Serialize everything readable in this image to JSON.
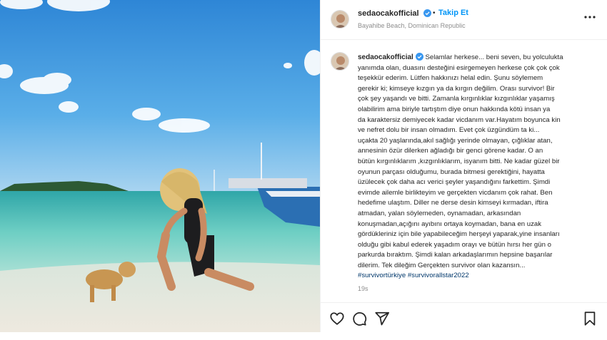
{
  "post": {
    "username": "sedaocakofficial",
    "verified": true,
    "follow_label": "Takip Et",
    "separator": "•",
    "location": "Bayahibe Beach, Dominican Republic",
    "caption_lines": [
      "Selamlar herkese... beni seven, bu yolculukta",
      "yanımda olan, duasını desteğini esirgemeyen herkese çok çok çok",
      "teşekkür ederim. Lütfen hakkınızı helal edin. Şunu söylemem",
      "gerekir ki; kimseye kızgın ya da kırgın değilim. Orası survivor! Bir",
      "çok şey yaşandı ve bitti. Zamanla kırgınlıklar kızgınlıklar yaşamış",
      "olabilirim ama biriyle tartıştım diye onun hakkında kötü insan ya",
      "da karaktersiz demiyecek kadar vicdanım var.Hayatım boyunca kin",
      "ve nefret dolu bir insan olmadım. Evet çok üzgündüm ta ki...",
      "uçakta 20 yaşlarında,akıl sağlığı yerinde olmayan, çığlıklar atan,",
      "annesinin özür dilerken ağladığı bir genci görene kadar. O an",
      "bütün kırgınlıklarım ,kızgınlıklarım, isyanım bitti. Ne kadar güzel bir",
      "oyunun parçası olduğumu, burada bitmesi gerektiğini, hayatta",
      "üzülecek çok daha acı verici şeyler yaşandığını farkettim. Şimdi",
      "evimde ailemle birlikteyim ve gerçekten vicdanım çok rahat. Ben",
      "hedefime ulaştım. Diller ne derse desin kimseyi kırmadan, iftira",
      "atmadan, yalan söylemeden, oynamadan, arkasından",
      "konuşmadan,açığını ayıbını ortaya koymadan, bana en uzak",
      "gördükleriniz için bile yapabileceğim herşeyi yaparak,yine insanları",
      "olduğu gibi kabul ederek yaşadım orayı ve bütün hırsı her gün o",
      "parkurda bıraktım. Şimdi kalan arkadaşlarımın hepsine başarılar",
      "dilerim. Tek dileğim Gerçekten survivor olan kazansın..."
    ],
    "hashtags": "#survivortürkiye #survivorallstar2022",
    "timestamp": "19s"
  },
  "icons": {
    "verified": "verified-badge-icon",
    "more": "more-options-icon",
    "like": "heart-icon",
    "comment": "comment-icon",
    "share": "share-icon",
    "save": "bookmark-icon"
  },
  "colors": {
    "accent": "#0095f6",
    "verified": "#3897f0",
    "text": "#262626",
    "muted": "#8e8e8e",
    "hashtag": "#00376b"
  }
}
